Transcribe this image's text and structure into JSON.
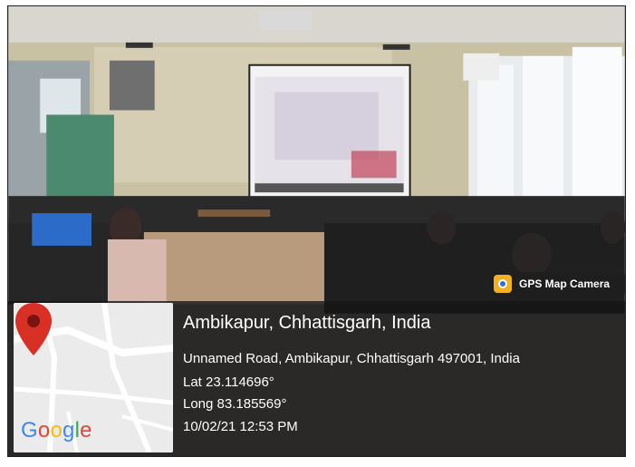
{
  "location": {
    "place": "Ambikapur, Chhattisgarh, India",
    "address": "Unnamed Road, Ambikapur, Chhattisgarh 497001, India",
    "latitude": "Lat 23.114696°",
    "longitude": "Long 83.185569°",
    "datetime": "10/02/21 12:53 PM"
  },
  "badge": {
    "label": "GPS Map Camera",
    "icon": "gps-map-camera-icon"
  },
  "map": {
    "logo_letters": [
      "G",
      "o",
      "o",
      "g",
      "l",
      "e"
    ],
    "logo_colors": [
      "#4285F4",
      "#EA4335",
      "#FBBC05",
      "#4285F4",
      "#34A853",
      "#EA4335"
    ],
    "pin_color": "#d93025"
  },
  "colors": {
    "overlay": "#141414",
    "text": "#ffffff"
  }
}
